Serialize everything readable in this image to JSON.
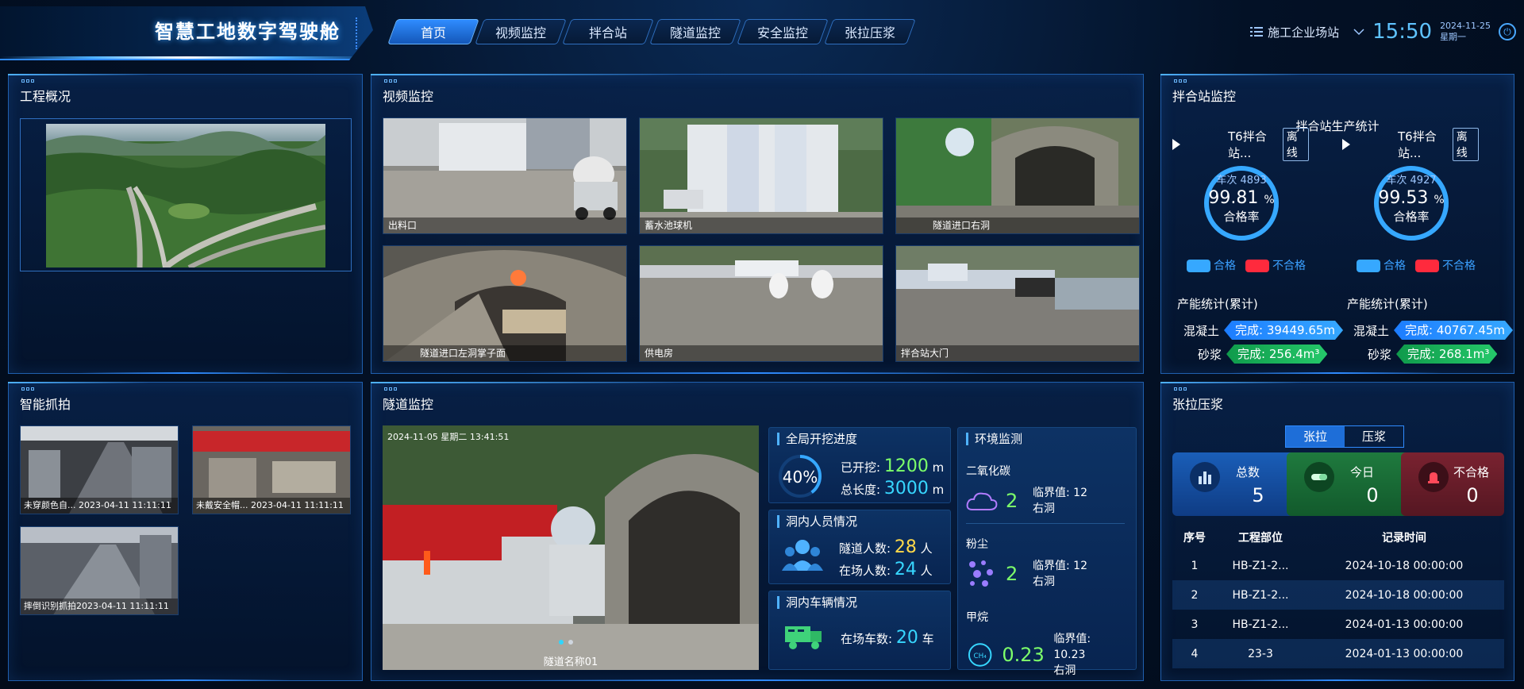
{
  "header": {
    "title": "智慧工地数字驾驶舱",
    "nav": [
      "首页",
      "视频监控",
      "拌合站",
      "隧道监控",
      "安全监控",
      "张拉压浆"
    ],
    "active_nav": 0,
    "site": "施工企业场站",
    "time": "15:50",
    "date": "2024-11-25",
    "weekday": "星期一"
  },
  "overview": {
    "title": "工程概况"
  },
  "video": {
    "title": "视频监控",
    "cams": [
      "出料口",
      "蓄水池球机",
      "隧道进口右洞",
      "隧道进口左洞掌子面",
      "供电房",
      "拌合站大门"
    ]
  },
  "mixer": {
    "title": "拌合站监控",
    "subtitle": "拌合站生产统计",
    "legend_ok": "合格",
    "legend_bad": "不合格",
    "prod_title": "产能统计(累计)",
    "concrete_label": "混凝土",
    "mortar_label": "砂浆",
    "stations": [
      {
        "name": "T6拌合站...",
        "status": "离线",
        "count": "车次 4893",
        "rate": "99.81",
        "rate_unit": "%",
        "rate_label": "合格率",
        "rate_value": 99.81,
        "concrete": "完成: 39449.65m",
        "mortar": "完成: 256.4m³"
      },
      {
        "name": "T6拌合站...",
        "status": "离线",
        "count": "车次 4927",
        "rate": "99.53",
        "rate_unit": "%",
        "rate_label": "合格率",
        "rate_value": 99.53,
        "concrete": "完成: 40767.45m",
        "mortar": "完成: 268.1m³"
      }
    ],
    "colors": {
      "ok": "#36a8ff",
      "bad": "#ff2a3d"
    }
  },
  "snap": {
    "title": "智能抓拍",
    "items": [
      "未穿颜色自... 2023-04-11 11:11:11",
      "未戴安全帽... 2023-04-11 11:11:11",
      "摔倒识别抓拍2023-04-11 11:11:11"
    ]
  },
  "tunnel": {
    "title": "隧道监控",
    "overlay_time": "2024-11-05 星期二 13:41:51",
    "caption": "隧道名称01",
    "excavation": {
      "title": "全局开挖进度",
      "pct": "40%",
      "pct_value": 40,
      "dug_label": "已开挖:",
      "dug_value": "1200",
      "total_label": "总长度:",
      "total_value": "3000",
      "unit": "m"
    },
    "people": {
      "title": "洞内人员情况",
      "tunnel_label": "隧道人数:",
      "tunnel_value": "28",
      "site_label": "在场人数:",
      "site_value": "24",
      "unit": "人"
    },
    "vehicles": {
      "title": "洞内车辆情况",
      "label": "在场车数:",
      "value": "20",
      "unit": "车"
    },
    "env": {
      "title": "环境监测",
      "items": [
        {
          "name": "二氧化碳",
          "value": "2",
          "threshold": "临界值: 12",
          "loc": "右洞",
          "icon_text": "CO₂"
        },
        {
          "name": "粉尘",
          "value": "2",
          "threshold": "临界值: 12",
          "loc": "右洞",
          "icon_text": ""
        },
        {
          "name": "甲烷",
          "value": "0.23",
          "threshold": "临界值: 10.23",
          "loc": "右洞",
          "icon_text": "CH₄"
        }
      ]
    }
  },
  "stretch": {
    "title": "张拉压浆",
    "tabs": [
      "张拉",
      "压浆"
    ],
    "active_tab": 0,
    "stats": [
      {
        "label": "总数",
        "value": "5",
        "color": "#1a5eb8"
      },
      {
        "label": "今日",
        "value": "0",
        "color": "#1f7a3e"
      },
      {
        "label": "不合格",
        "value": "0",
        "color": "#7a2230"
      }
    ],
    "columns": [
      "序号",
      "工程部位",
      "记录时间"
    ],
    "rows": [
      [
        "1",
        "HB-Z1-2...",
        "2024-10-18 00:00:00"
      ],
      [
        "2",
        "HB-Z1-2...",
        "2024-10-18 00:00:00"
      ],
      [
        "3",
        "HB-Z1-2...",
        "2024-01-13 00:00:00"
      ],
      [
        "4",
        "23-3",
        "2024-01-13 00:00:00"
      ]
    ]
  }
}
